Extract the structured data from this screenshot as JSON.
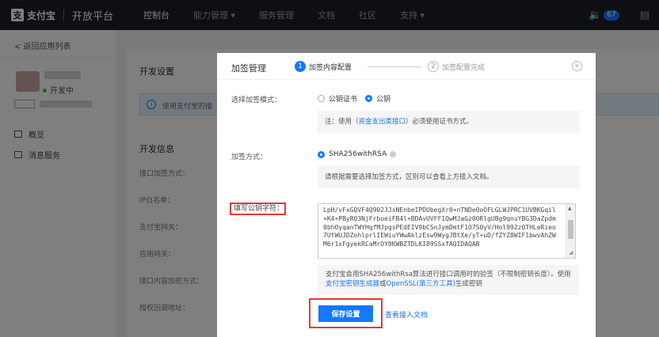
{
  "topbar": {
    "logo_mark": "支",
    "logo_text": "支付宝",
    "platform": "开放平台",
    "nav": [
      "控制台",
      "能力管理 ▾",
      "服务管理",
      "文档",
      "社区",
      "支持 ▾"
    ],
    "badge": "67"
  },
  "sidebar": {
    "back": "< 返回应用列表",
    "status": "开发中",
    "menu": [
      "概览",
      "消息服务"
    ]
  },
  "main": {
    "title": "开发设置",
    "info": "使用支付宝的接",
    "sub_title": "开发信息",
    "rows": [
      "接口加签方式：",
      "IP白名单：",
      "支付宝网关：",
      "应用网关：",
      "接口内容加密方式：",
      "授权回调地址："
    ]
  },
  "modal": {
    "title": "加签管理",
    "step1_num": "1",
    "step1_label": "加签内容配置",
    "step2_num": "2",
    "step2_label": "加签配置完成",
    "close": "✕",
    "mode_label": "选择加签模式：",
    "mode_options": [
      "公钥证书",
      "公钥"
    ],
    "mode_note_prefix": "注：使用（",
    "mode_note_link": "资金支出类接口",
    "mode_note_suffix": "）必须使用证书方式。",
    "method_label": "加签方式：",
    "method_value": "SHA256withRSA",
    "method_note": "请根据需要选择加签方式，区别可以查看上方接入文档。",
    "pk_label": "填写公钥字符：",
    "pk_value": "LpH/vFxGQVF4Q902JJsNEnbeIPDUbegXr0+nTNDeOoOFLGLWJPRC1UVBKGqil+K4+PByR03NjFrbueiFB4l+BDAvUVFF1QwMJaGz0ORlgUBg9qnuYBG3DaZpdm0bhOyqanTWYHqfMJpgsPEdEIV9bCSnJymDmtF1O7S0yV/Hol992z0THLeRieo7UtWUJDZohlprlIEWiuYWwAklzEsw9WygJBtXe/yT+uD/fZYZ8WIF1bwvAhZWM6r1xFgyekRCaMrOY0KWBZTDLKI89SSxfAQIDAQAB",
    "tip_prefix": "支付宝会用SHA256withRsa算法进行接口调用时的验签（不限制密钥长度）。使用",
    "tip_link1": "支付宝密钥生成器",
    "tip_mid": "或",
    "tip_link2": "OpenSSL(第三方工具)",
    "tip_suffix": "生成密钥",
    "save": "保存设置",
    "doc_link": "查看接入文档"
  }
}
